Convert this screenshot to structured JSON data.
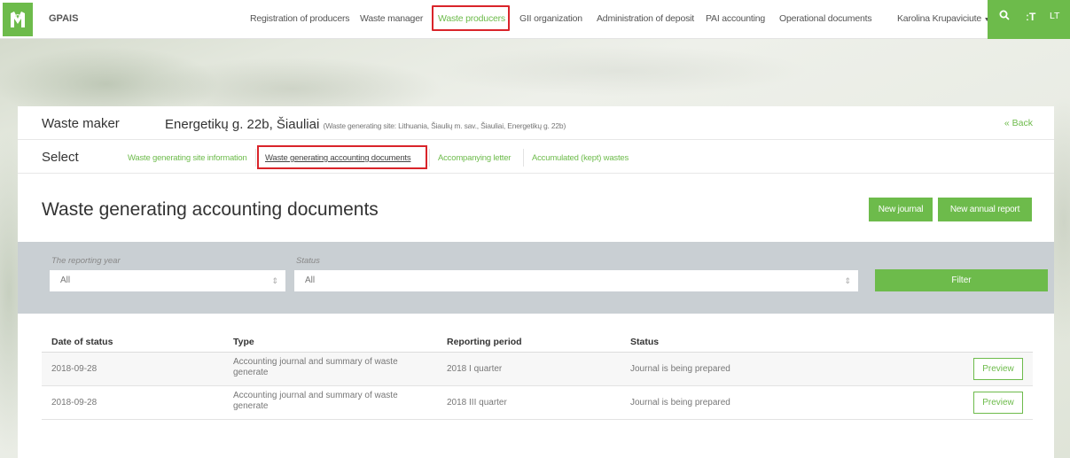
{
  "app": {
    "brand": "GPAIS"
  },
  "nav": {
    "items": [
      {
        "label": "Registration of producers"
      },
      {
        "label": "Waste manager"
      },
      {
        "label": "Waste producers"
      },
      {
        "label": "GII organization"
      },
      {
        "label": "Administration of deposit"
      },
      {
        "label": "PAI accounting"
      },
      {
        "label": "Operational documents"
      }
    ],
    "user": "Karolina Krupaviciute",
    "lang": "LT"
  },
  "header": {
    "label": "Waste maker",
    "address": "Energetikų g. 22b, Šiauliai",
    "address_detail": "(Waste generating site: Lithuania, Šiaulių m. sav., Šiauliai, Energetikų g. 22b)",
    "back": "« Back"
  },
  "select": {
    "label": "Select",
    "tabs": [
      {
        "label": "Waste generating site information"
      },
      {
        "label": "Waste generating accounting documents"
      },
      {
        "label": "Accompanying letter"
      },
      {
        "label": "Accumulated (kept) wastes"
      }
    ]
  },
  "main": {
    "title": "Waste generating accounting documents",
    "new_journal": "New journal",
    "new_annual_report": "New annual report"
  },
  "filter": {
    "year_label": "The reporting year",
    "year_value": "All",
    "status_label": "Status",
    "status_value": "All",
    "button": "Filter"
  },
  "table": {
    "columns": [
      "Date of status",
      "Type",
      "Reporting period",
      "Status"
    ],
    "rows": [
      {
        "date": "2018-09-28",
        "type": "Accounting journal and summary of waste generate",
        "period": "2018 I quarter",
        "status": "Journal is being prepared",
        "action": "Preview"
      },
      {
        "date": "2018-09-28",
        "type": "Accounting journal and summary of waste generate",
        "period": "2018 III quarter",
        "status": "Journal is being prepared",
        "action": "Preview"
      }
    ]
  },
  "colors": {
    "accent": "#6dbb4b",
    "highlight": "#d9242a",
    "filter_bg": "#c9cfd3"
  }
}
